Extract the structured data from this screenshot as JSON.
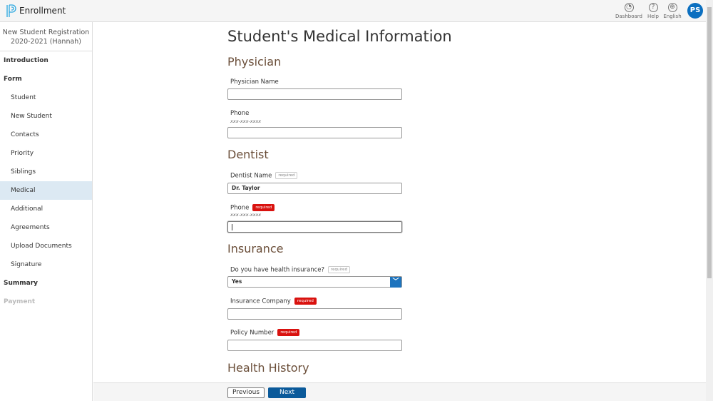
{
  "header": {
    "app_title": "Enrollment",
    "dashboard": "Dashboard",
    "help": "Help",
    "language": "English",
    "avatar_initials": "PS",
    "brand_color": "#2aa8e0"
  },
  "sidebar": {
    "title_line1": "New Student Registration",
    "title_line2": "2020-2021 (Hannah)",
    "items": [
      {
        "label": "Introduction",
        "type": "section"
      },
      {
        "label": "Form",
        "type": "section"
      },
      {
        "label": "Student"
      },
      {
        "label": "New Student"
      },
      {
        "label": "Contacts"
      },
      {
        "label": "Priority"
      },
      {
        "label": "Siblings"
      },
      {
        "label": "Medical",
        "active": true
      },
      {
        "label": "Additional"
      },
      {
        "label": "Agreements"
      },
      {
        "label": "Upload Documents"
      },
      {
        "label": "Signature"
      },
      {
        "label": "Summary",
        "type": "section"
      },
      {
        "label": "Payment",
        "type": "disabled"
      }
    ]
  },
  "page": {
    "title": "Student's Medical Information",
    "physician": {
      "heading": "Physician",
      "name_label": "Physician Name",
      "name_value": "",
      "phone_label": "Phone",
      "phone_hint": "xxx-xxx-xxxx",
      "phone_value": ""
    },
    "dentist": {
      "heading": "Dentist",
      "name_label": "Dentist Name",
      "name_badge": "required",
      "name_value": "Dr. Taylor",
      "phone_label": "Phone",
      "phone_badge": "required",
      "phone_hint": "xxx-xxx-xxxx",
      "phone_value": ""
    },
    "insurance": {
      "heading": "Insurance",
      "has_label": "Do you have health insurance?",
      "has_badge": "required",
      "has_value": "Yes",
      "company_label": "Insurance Company",
      "company_badge": "required",
      "company_value": "",
      "policy_label": "Policy Number",
      "policy_badge": "required",
      "policy_value": ""
    },
    "health_history": {
      "heading": "Health History"
    }
  },
  "footer": {
    "previous": "Previous",
    "next": "Next"
  }
}
